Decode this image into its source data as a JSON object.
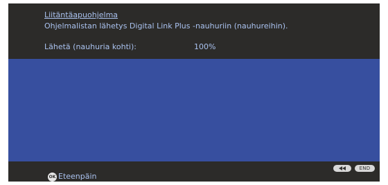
{
  "header": {
    "title": "Liitäntäapuohjelma",
    "description": "Ohjelmalistan lähetys Digital Link Plus -nauhuriin (nauhureihin).",
    "send_label": "Lähetä (nauhuria kohti):",
    "send_value": "100%"
  },
  "footer": {
    "ok_glyph": "OK",
    "ok_label": "Eteenpäin",
    "end_label": "END",
    "rewind_icon": "rewind-icon"
  },
  "colors": {
    "background": "#2c2b29",
    "panel": "#374f9f",
    "text": "#aac2ef"
  }
}
